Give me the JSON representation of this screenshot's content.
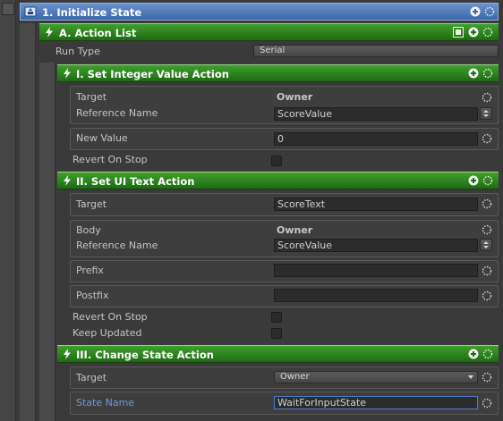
{
  "state": {
    "title": "1. Initialize State"
  },
  "action_list": {
    "title": "A. Action List",
    "run_type_label": "Run Type",
    "run_type_value": "Serial"
  },
  "action1": {
    "title": "I. Set Integer Value Action",
    "target_label": "Target",
    "target_value": "Owner",
    "ref_label": "Reference Name",
    "ref_value": "ScoreValue",
    "new_value_label": "New Value",
    "new_value": "0",
    "revert_label": "Revert On Stop"
  },
  "action2": {
    "title": "II. Set UI Text Action",
    "target_label": "Target",
    "target_value": "ScoreText",
    "body_label": "Body",
    "body_value": "Owner",
    "ref_label": "Reference Name",
    "ref_value": "ScoreValue",
    "prefix_label": "Prefix",
    "prefix_value": "",
    "postfix_label": "Postfix",
    "postfix_value": "",
    "revert_label": "Revert On Stop",
    "keep_label": "Keep Updated"
  },
  "action3": {
    "title": "III. Change State Action",
    "target_label": "Target",
    "target_value": "Owner",
    "state_name_label": "State Name",
    "state_name_value": "WaitForInputState"
  },
  "colors": {
    "header_green": "#2e8a1f",
    "header_blue": "#4f7bbf",
    "label_blue": "#6d9ae0",
    "background": "#3a3a3a"
  }
}
